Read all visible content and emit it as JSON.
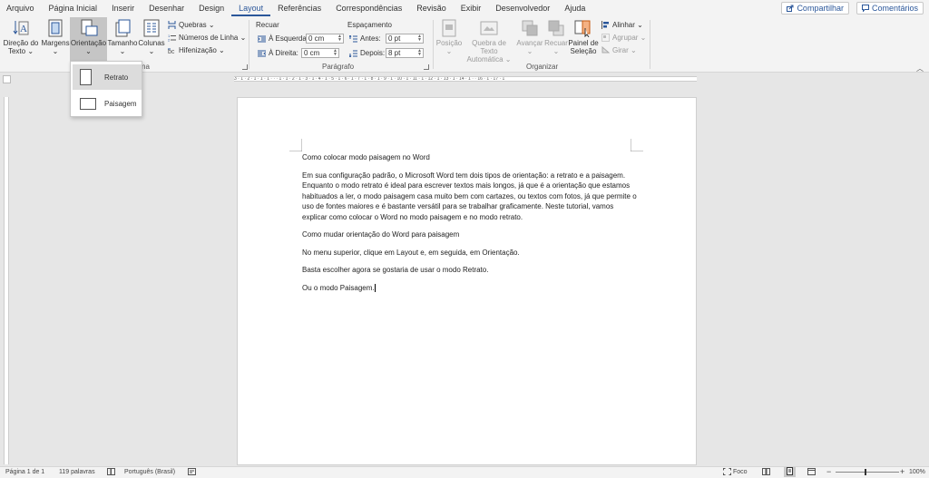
{
  "menu": {
    "tabs": [
      {
        "label": "Arquivo"
      },
      {
        "label": "Página Inicial"
      },
      {
        "label": "Inserir"
      },
      {
        "label": "Desenhar"
      },
      {
        "label": "Design"
      },
      {
        "label": "Layout"
      },
      {
        "label": "Referências"
      },
      {
        "label": "Correspondências"
      },
      {
        "label": "Revisão"
      },
      {
        "label": "Exibir"
      },
      {
        "label": "Desenvolvedor"
      },
      {
        "label": "Ajuda"
      }
    ],
    "active_tab": "Layout",
    "share_label": "Compartilhar",
    "comments_label": "Comentários"
  },
  "ribbon": {
    "direction": {
      "line1": "Direção do",
      "line2": "Texto ⌄"
    },
    "margins": {
      "line1": "Margens",
      "line2": "⌄"
    },
    "orientation": {
      "line1": "Orientação",
      "line2": "⌄"
    },
    "size": {
      "line1": "Tamanho",
      "line2": "⌄"
    },
    "columns": {
      "line1": "Colunas",
      "line2": "⌄"
    },
    "breaks": "Quebras ⌄",
    "line_numbers": "Números de Linha ⌄",
    "hyphenation": "Hifenização ⌄",
    "page_setup_partial": "na",
    "indent": {
      "title": "Recuar",
      "left_label": "À Esquerda:",
      "left_value": "0 cm",
      "right_label": "À Direita:",
      "right_value": "0 cm"
    },
    "spacing": {
      "title": "Espaçamento",
      "before_label": "Antes:",
      "before_value": "0 pt",
      "after_label": "Depois:",
      "after_value": "8 pt"
    },
    "paragraph_group": "Parágrafo",
    "position": {
      "line1": "Posição",
      "line2": "⌄"
    },
    "wrap_text": {
      "line1": "Quebra de Texto",
      "line2": "Automática ⌄"
    },
    "bring_forward": {
      "line1": "Avançar",
      "line2": "⌄"
    },
    "send_backward": {
      "line1": "Recuar",
      "line2": "⌄"
    },
    "selection_pane": {
      "line1": "Painel de",
      "line2": "Seleção"
    },
    "align": "Alinhar ⌄",
    "group": "Agrupar ⌄",
    "rotate": "Girar ⌄",
    "arrange_group": "Organizar"
  },
  "dropdown": {
    "portrait": "Retrato",
    "landscape": "Paisagem"
  },
  "ruler_numbers": "3 · 1 · 2 · 1 · 1 · 1 · · · 1 · 1 · 2 · 1 · 3 · 1 · 4 · 1 · 5 · 1 · 6 · 1 · 7 · 1 · 8 · 1 · 9 · 1 · 10 · 1 · 11 · 1 · 12 · 1 · 13 · 1 · 14 · 1 · · 16 · 1 · 17 · 1",
  "document": {
    "paragraphs": [
      "Como colocar modo paisagem no Word",
      "Em sua configuração padrão, o Microsoft Word tem dois tipos de orientação: a retrato e a paisagem. Enquanto o modo retrato é ideal para escrever textos mais longos, já que é a orientação que estamos habituados a ler, o modo paisagem casa muito bem com cartazes, ou textos com fotos, já que permite o uso de fontes maiores e é bastante versátil para se trabalhar graficamente. Neste tutorial, vamos explicar como colocar o Word no modo paisagem e no modo retrato.",
      "Como mudar orientação do Word para paisagem",
      "No menu superior, clique em Layout e, em seguida, em Orientação.",
      "Basta escolher agora se gostaria de usar o modo Retrato.",
      "Ou o modo Paisagem."
    ]
  },
  "status": {
    "page": "Página 1 de 1",
    "words": "119 palavras",
    "language": "Português (Brasil)",
    "focus": "Foco",
    "zoom": "100%"
  },
  "colors": {
    "accent": "#2b579a",
    "ribbon_bg": "#f3f3f3",
    "canvas_bg": "#e6e6e6"
  }
}
